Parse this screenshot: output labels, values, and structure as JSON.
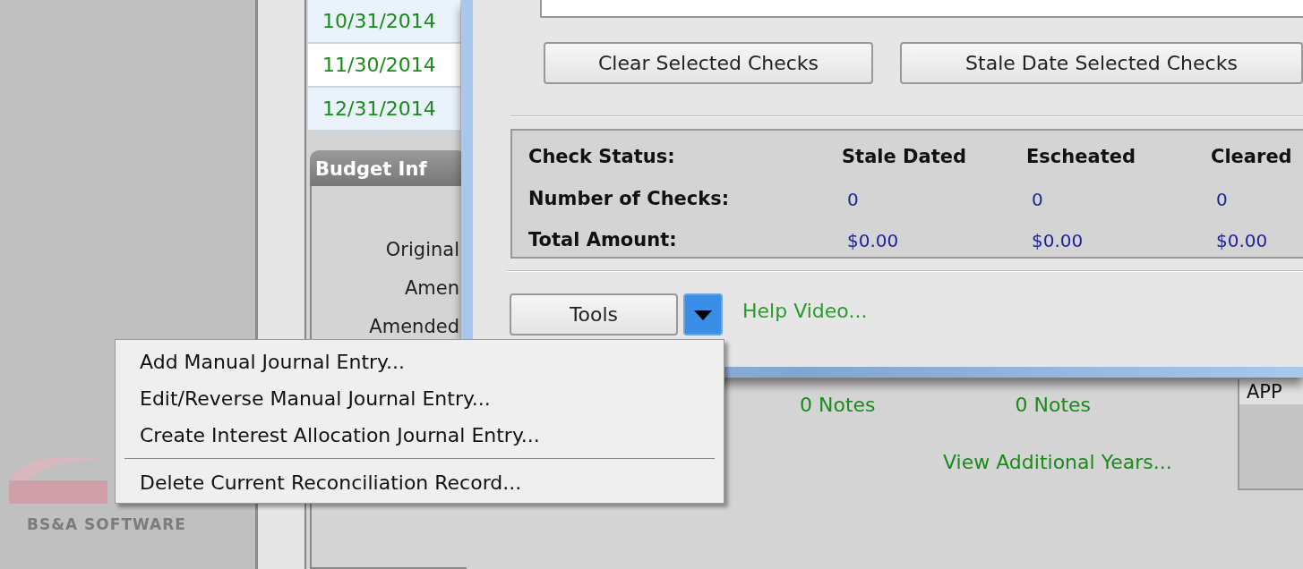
{
  "background_app": {
    "dates": [
      "10/31/2014",
      "11/30/2014",
      "12/31/2014"
    ],
    "budget_panel": {
      "title": "Budget Inf",
      "labels": [
        "Original",
        "Amen",
        "Amended"
      ]
    },
    "notes": [
      "0 Notes",
      "0 Notes"
    ],
    "view_link": "View Additional Years...",
    "side_panel": {
      "header": "APP"
    },
    "logo": {
      "text": "BS&A SOFTWARE"
    }
  },
  "dialog": {
    "buttons": [
      "Clear Selected Checks",
      "Stale Date Selected Checks"
    ],
    "status": {
      "header_label": "Check Status:",
      "columns": [
        "Stale Dated",
        "Escheated",
        "Cleared"
      ],
      "rows": [
        {
          "label": "Number of Checks:",
          "values": [
            "0",
            "0",
            "0"
          ]
        },
        {
          "label": "Total Amount:",
          "values": [
            "$0.00",
            "$0.00",
            "$0.00"
          ]
        }
      ]
    },
    "tools_button": "Tools",
    "tools_dropdown": {
      "expanded": true
    },
    "help_link": "Help Video..."
  },
  "menu": {
    "items": [
      {
        "kind": "item",
        "label": "Add Manual Journal Entry..."
      },
      {
        "kind": "item",
        "label": "Edit/Reverse Manual Journal Entry..."
      },
      {
        "kind": "item",
        "label": "Create Interest Allocation Journal Entry..."
      },
      {
        "kind": "separator"
      },
      {
        "kind": "item",
        "label": "Delete Current Reconciliation Record..."
      }
    ]
  }
}
